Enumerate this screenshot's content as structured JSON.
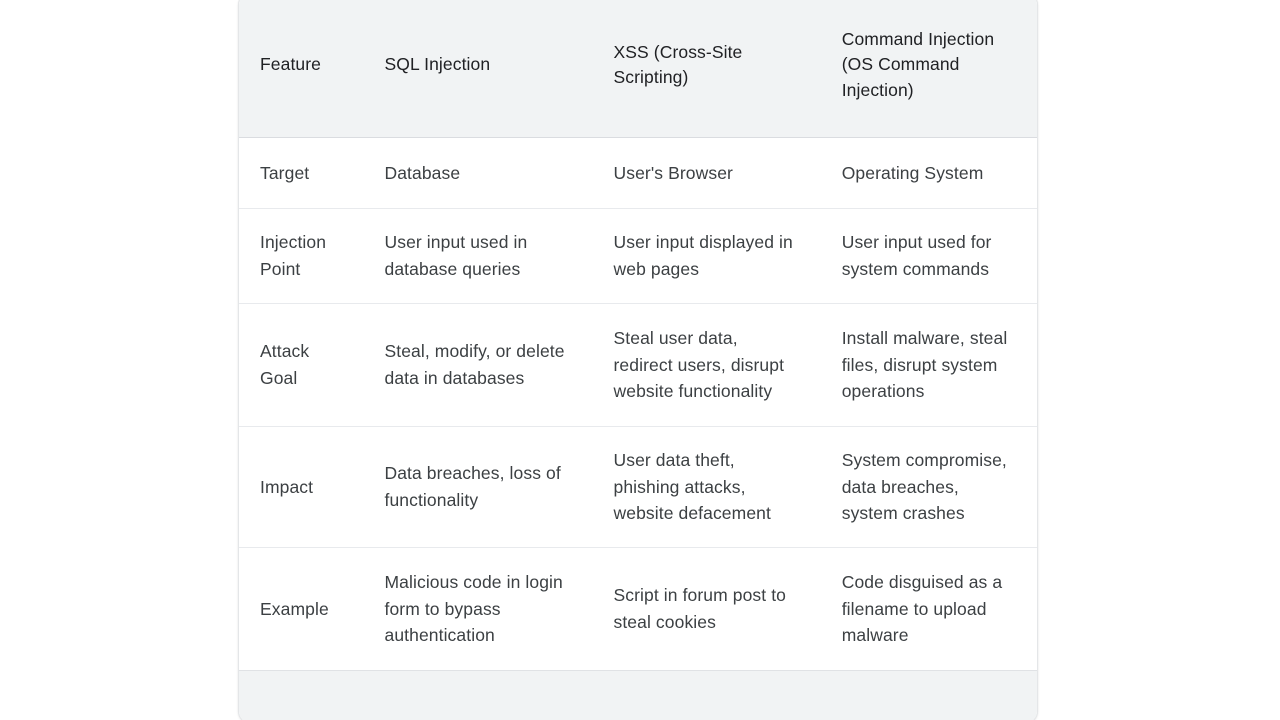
{
  "table": {
    "headers": [
      "Feature",
      "SQL Injection",
      "XSS (Cross-Site Scripting)",
      "Command Injection (OS Command Injection)"
    ],
    "rows": [
      {
        "feature": "Target",
        "sql_injection": "Database",
        "xss": "User's Browser",
        "command_injection": "Operating System"
      },
      {
        "feature": "Injection Point",
        "sql_injection": "User input used in database queries",
        "xss": "User input displayed in web pages",
        "command_injection": "User input used for system commands"
      },
      {
        "feature": "Attack Goal",
        "sql_injection": "Steal, modify, or delete data in databases",
        "xss": "Steal user data, redirect users, disrupt website functionality",
        "command_injection": "Install malware, steal files, disrupt system operations"
      },
      {
        "feature": "Impact",
        "sql_injection": "Data breaches, loss of functionality",
        "xss": "User data theft, phishing attacks, website defacement",
        "command_injection": "System compromise, data breaches, system crashes"
      },
      {
        "feature": "Example",
        "sql_injection": "Malicious code in login form to bypass authentication",
        "xss": "Script in forum post to steal cookies",
        "command_injection": "Code disguised as a filename to upload malware"
      }
    ],
    "footer": ""
  },
  "colors": {
    "page_background": "#ffffff",
    "header_background": "#f1f3f4",
    "footer_background": "#f1f3f4",
    "header_text": "#202124",
    "body_text": "#3c4043",
    "divider": "#e8eaed",
    "card_border": "#e4e6e8"
  }
}
